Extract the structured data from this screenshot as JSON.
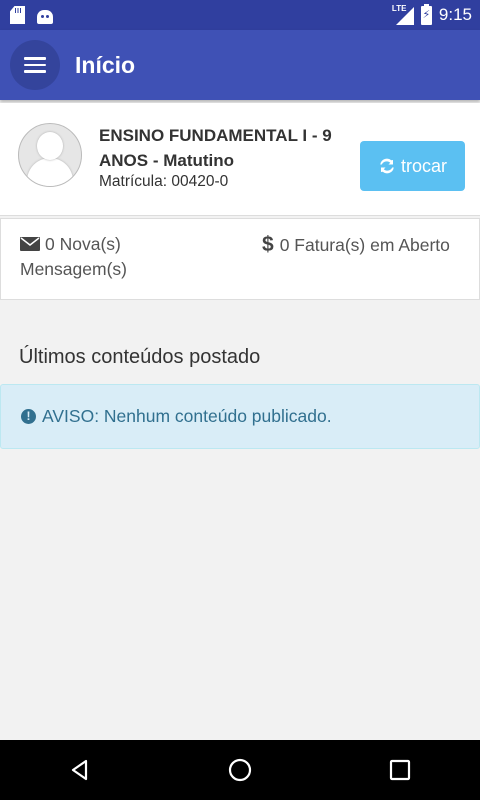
{
  "status_bar": {
    "time": "9:15",
    "network": "LTE",
    "icons": [
      "sd-card-icon",
      "android-icon",
      "lte-signal-icon",
      "battery-charging-icon"
    ]
  },
  "app_bar": {
    "title": "Início",
    "menu_icon": "hamburger-menu-icon"
  },
  "profile": {
    "course": "ENSINO FUNDAMENTAL I - 9 ANOS - Matutino",
    "matricula": "Matrícula: 00420-0",
    "swap_label": "trocar",
    "swap_icon": "refresh-icon",
    "button_color": "#5bc0f2"
  },
  "summary": {
    "messages": "0 Nova(s) Mensagem(s)",
    "messages_icon": "envelope-icon",
    "invoices": "0 Fatura(s) em Aberto",
    "invoices_icon": "dollar-icon"
  },
  "content": {
    "section_title": "Últimos conteúdos postado",
    "alert_text": "AVISO: Nenhum conteúdo publicado.",
    "alert_icon": "info-icon"
  },
  "nav_bar": {
    "icons": [
      "back-icon",
      "home-icon",
      "recents-icon"
    ]
  },
  "colors": {
    "primary": "#3f51b5",
    "primary_dark": "#303f9f",
    "alert_bg": "#d9edf7",
    "alert_text": "#31708f"
  }
}
